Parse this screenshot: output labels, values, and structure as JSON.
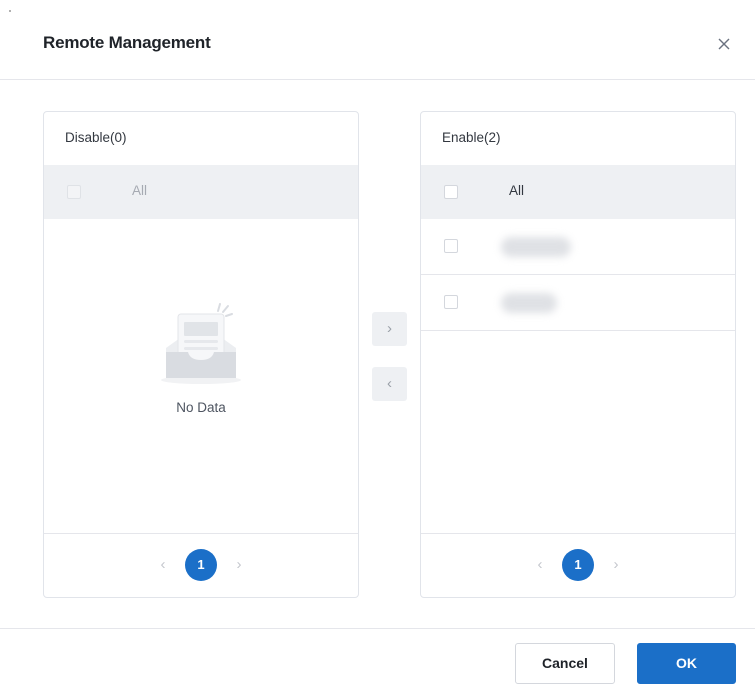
{
  "dialog": {
    "title": "Remote Management"
  },
  "left_panel": {
    "title": "Disable(0)",
    "all_label": "All",
    "empty_text": "No Data",
    "pagination": {
      "prev": "‹",
      "current": "1",
      "next": "›"
    }
  },
  "right_panel": {
    "title": "Enable(2)",
    "all_label": "All",
    "items_blurred": 2,
    "pagination": {
      "prev": "‹",
      "current": "1",
      "next": "›"
    }
  },
  "transfer": {
    "to_right": "›",
    "to_left": "‹"
  },
  "footer": {
    "cancel_label": "Cancel",
    "ok_label": "OK"
  },
  "colors": {
    "accent": "#1b6fc8",
    "header_row_bg": "#eef0f3",
    "border": "#e1e4ea"
  }
}
